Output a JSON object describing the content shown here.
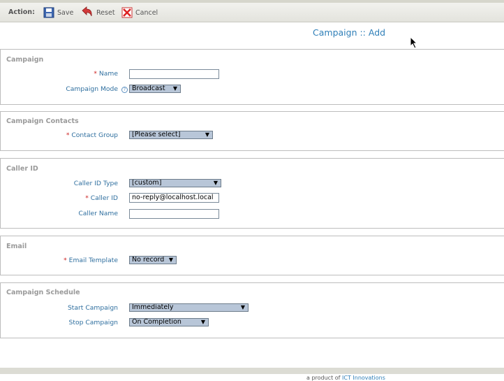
{
  "actionbar": {
    "label": "Action:",
    "save_label": "Save",
    "reset_label": "Reset",
    "cancel_label": "Cancel"
  },
  "page": {
    "title": "Campaign :: Add"
  },
  "sections": {
    "campaign": {
      "legend": "Campaign",
      "name_label": "Name",
      "name_value": "",
      "mode_label": "Campaign Mode",
      "mode_value": "Broadcast"
    },
    "contacts": {
      "legend": "Campaign Contacts",
      "group_label": "Contact Group",
      "group_value": "[Please select]"
    },
    "callerid": {
      "legend": "Caller ID",
      "type_label": "Caller ID Type",
      "type_value": "[custom]",
      "id_label": "Caller ID",
      "id_value": "no-reply@localhost.local",
      "name_label": "Caller Name",
      "name_value": ""
    },
    "email": {
      "legend": "Email",
      "template_label": "Email Template",
      "template_value": "No record"
    },
    "schedule": {
      "legend": "Campaign Schedule",
      "start_label": "Start Campaign",
      "start_value": "Immediately",
      "stop_label": "Stop Campaign",
      "stop_value": "On Completion"
    }
  },
  "common": {
    "required_mark": "*",
    "help_mark": "?",
    "dropdown_arrow": "▼"
  },
  "footer": {
    "text": "a product of",
    "link_text": "ICT Innovations"
  },
  "colors": {
    "accent": "#2f7fb8",
    "label": "#2f6f9f",
    "required": "#cc2222",
    "select_bg": "#b8c6d8"
  },
  "icons": [
    "save-icon",
    "reset-icon",
    "cancel-icon",
    "help-icon",
    "mouse-cursor"
  ]
}
